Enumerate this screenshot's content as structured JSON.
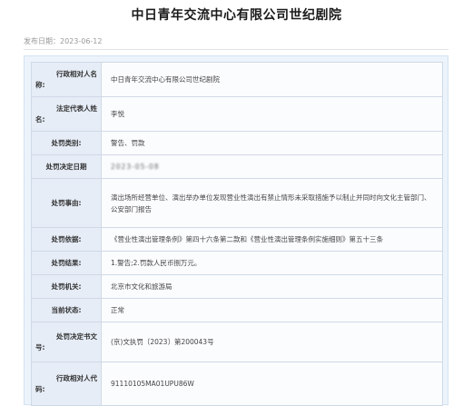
{
  "page": {
    "title": "中日青年交流中心有限公司世纪剧院",
    "publish_date": "发布日期：2023-06-12"
  },
  "rows": [
    {
      "label_top": "行政相对人名",
      "label_bottom": "称:",
      "value": "中日青年交流中心有限公司世纪剧院"
    },
    {
      "label_top": "法定代表人姓",
      "label_bottom": "名:",
      "value": "李悦"
    },
    {
      "label": "处罚类别:",
      "value": "警告、罚款"
    },
    {
      "label": "处罚决定日期",
      "value": "2023-05-08"
    },
    {
      "label": "处罚事由:",
      "value": "演出场所经营单位、演出举办单位发现营业性演出有禁止情形未采取措施予以制止并同时向文化主管部门、公安部门报告"
    },
    {
      "label": "处罚依据:",
      "value": "《营业性演出管理条例》第四十六条第二款和《营业性演出管理条例实施细则》第五十三条"
    },
    {
      "label": "处罚结果:",
      "value": "1.警告;2.罚款人民币捌万元。"
    },
    {
      "label": "处罚机关:",
      "value": "北京市文化和旅游局"
    },
    {
      "label": "当前状态:",
      "value": "正常"
    },
    {
      "label_top": "处罚决定书文",
      "label_bottom": "号:",
      "value": "(京)文执罚〔2023〕第200043号"
    },
    {
      "label_top": "行政相对人代",
      "label_bottom": "码:",
      "value": "91110105MA01UPU86W"
    }
  ]
}
